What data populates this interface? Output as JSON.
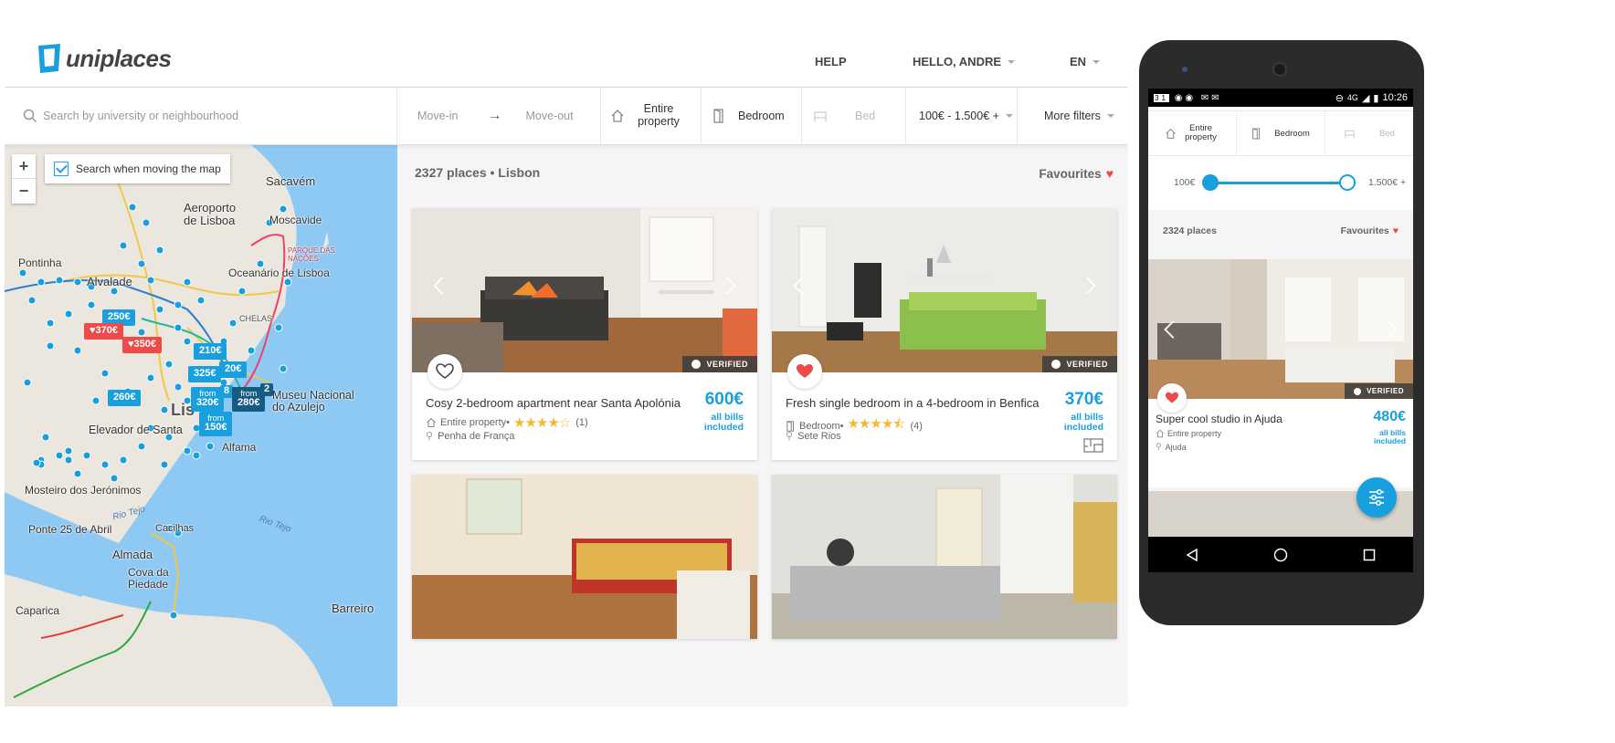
{
  "brand": {
    "name": "uniplaces"
  },
  "header": {
    "help": "HELP",
    "user": "HELLO, ANDRE",
    "lang": "EN"
  },
  "search": {
    "placeholder": "Search by university or neighbourhood",
    "move_in": "Move-in",
    "move_out": "Move-out",
    "type_entire": "Entire property",
    "type_bedroom": "Bedroom",
    "type_bed": "Bed",
    "price": "100€ - 1.500€ +",
    "more_filters": "More filters"
  },
  "map": {
    "search_toggle": "Search when moving the map",
    "zoom_in": "+",
    "zoom_out": "−",
    "labels": {
      "sacavem": "Sacavém",
      "aeroporto": "Aeroporto de Lisboa",
      "moscavide": "Moscavide",
      "parque": "PARQUE DAS NAÇÕES",
      "oceanario": "Oceanário de Lisboa",
      "pontinha": "Pontinha",
      "alvalade": "Alvalade",
      "chelas": "CHELAS",
      "museu": "Museu Nacional do Azulejo",
      "elevador": "Elevador de Santa",
      "lisboa": "Lis",
      "alfama": "Alfama",
      "mosteiro": "Mosteiro dos Jerónimos",
      "ponte": "Ponte 25 de Abril",
      "almada": "Almada",
      "cova": "Cova da Piedade",
      "caparica": "Caparica",
      "barreiro": "Barreiro",
      "rio_tejo": "Rio Tejo",
      "cacilhas": "Cacilhas"
    },
    "pins": {
      "p250": "250€",
      "p370": "♥370€",
      "p350": "♥350€",
      "p210": "210€",
      "p325": "325€",
      "p20": "20€",
      "p260": "260€",
      "p320_from": "from",
      "p320": "320€",
      "p280_from": "from",
      "p280": "280€",
      "p150_from": "from",
      "p150": "150€",
      "p8": "8",
      "p2": "2"
    }
  },
  "listings": {
    "summary": "2327 places • Lisbon",
    "favourites": "Favourites",
    "cards": [
      {
        "title": "Cosy 2-bedroom apartment near Santa Apolónia",
        "type": "Entire property",
        "rating_count": "(1)",
        "location": "Penha de França",
        "price": "600€",
        "bills": "all bills included",
        "verified": "VERIFIED",
        "rating": 4
      },
      {
        "title": "Fresh single bedroom in a 4-bedroom in Benfica",
        "type": "Bedroom",
        "rating_count": "(4)",
        "location": "Sete Rios",
        "price": "370€",
        "bills": "all bills included",
        "verified": "VERIFIED",
        "rating": 4.5
      }
    ]
  },
  "phone": {
    "status_time": "10:26",
    "status_net": "4G",
    "status_date_icon": "31",
    "filter_entire": "Entire property",
    "filter_bedroom": "Bedroom",
    "filter_bed": "Bed",
    "price_min": "100€",
    "price_max": "1.500€ +",
    "count": "2324 places",
    "favourites": "Favourites",
    "card": {
      "title": "Super cool studio in Ajuda",
      "type": "Entire property",
      "location": "Ajuda",
      "price": "480€",
      "bills": "all bills included",
      "verified": "VERIFIED"
    }
  },
  "colors": {
    "accent": "#1a9fde",
    "heart": "#ef4a4a",
    "star": "#f7b731"
  }
}
